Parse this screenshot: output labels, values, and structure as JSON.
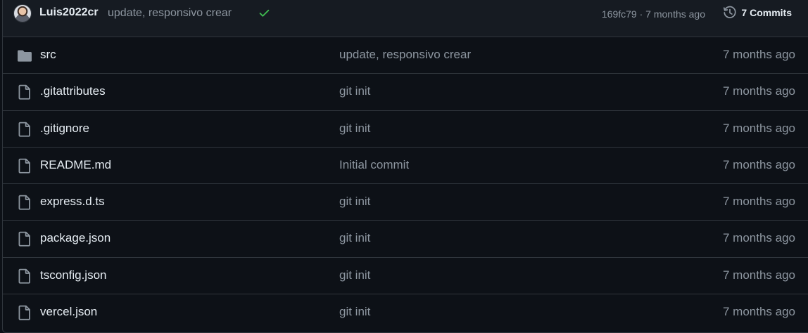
{
  "latest_commit": {
    "author": "Luis2022cr",
    "message": "update, responsivo crear",
    "sha_time": "169fc79 · 7 months ago",
    "commits_label": "7 Commits",
    "status_color": "#3fb950"
  },
  "colors": {
    "background": "#0d1117",
    "header_bg": "#161b22",
    "border": "#30363d",
    "text": "#e6edf3",
    "muted": "#8d96a0",
    "folder": "#8d96a0"
  },
  "files": [
    {
      "name": "src",
      "type": "folder",
      "icon": "folder-icon",
      "message": "update, responsivo crear",
      "time": "7 months ago"
    },
    {
      "name": ".gitattributes",
      "type": "file",
      "icon": "file-icon",
      "message": "git init",
      "time": "7 months ago"
    },
    {
      "name": ".gitignore",
      "type": "file",
      "icon": "file-icon",
      "message": "git init",
      "time": "7 months ago"
    },
    {
      "name": "README.md",
      "type": "file",
      "icon": "file-icon",
      "message": "Initial commit",
      "time": "7 months ago"
    },
    {
      "name": "express.d.ts",
      "type": "file",
      "icon": "file-icon",
      "message": "git init",
      "time": "7 months ago"
    },
    {
      "name": "package.json",
      "type": "file",
      "icon": "file-icon",
      "message": "git init",
      "time": "7 months ago"
    },
    {
      "name": "tsconfig.json",
      "type": "file",
      "icon": "file-icon",
      "message": "git init",
      "time": "7 months ago"
    },
    {
      "name": "vercel.json",
      "type": "file",
      "icon": "file-icon",
      "message": "git init",
      "time": "7 months ago"
    }
  ]
}
